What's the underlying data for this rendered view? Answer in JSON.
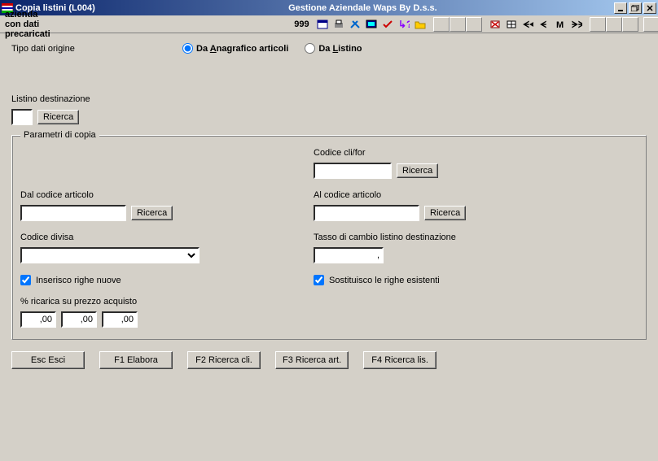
{
  "window": {
    "title": "Copia listini (L004)",
    "center_title": "Gestione Aziendale Waps By D.s.s."
  },
  "toolbar": {
    "subtitle": "azienda con dati precaricati",
    "number": "999"
  },
  "form": {
    "tipo_label": "Tipo dati origine",
    "radio_anagrafico_pre": "Da ",
    "radio_anagrafico_u": "A",
    "radio_anagrafico_post": "nagrafico articoli",
    "radio_listino_pre": "Da ",
    "radio_listino_u": "L",
    "radio_listino_post": "istino",
    "listino_dest_label": "Listino destinazione",
    "listino_dest_value": "",
    "ricerca_btn": "Ricerca",
    "group_legend": "Parametri di copia",
    "codice_clifor_label": "Codice cli/for",
    "codice_clifor_value": "",
    "dal_codice_label": "Dal codice articolo",
    "dal_codice_value": "",
    "al_codice_label": "Al codice articolo",
    "al_codice_value": "",
    "codice_divisa_label": "Codice divisa",
    "codice_divisa_value": "",
    "tasso_label": "Tasso di cambio listino destinazione",
    "tasso_value": ",",
    "inserisco_label": "Inserisco righe nuove",
    "sostituisco_label": "Sostituisco le righe esistenti",
    "ricarica_label": "% ricarica su prezzo acquisto",
    "ricarica1": ",00",
    "ricarica2": ",00",
    "ricarica3": ",00"
  },
  "buttons": {
    "esc": "Esc Esci",
    "f1": "F1 Elabora",
    "f2": "F2 Ricerca cli.",
    "f3": "F3 Ricerca art.",
    "f4": "F4 Ricerca lis."
  }
}
